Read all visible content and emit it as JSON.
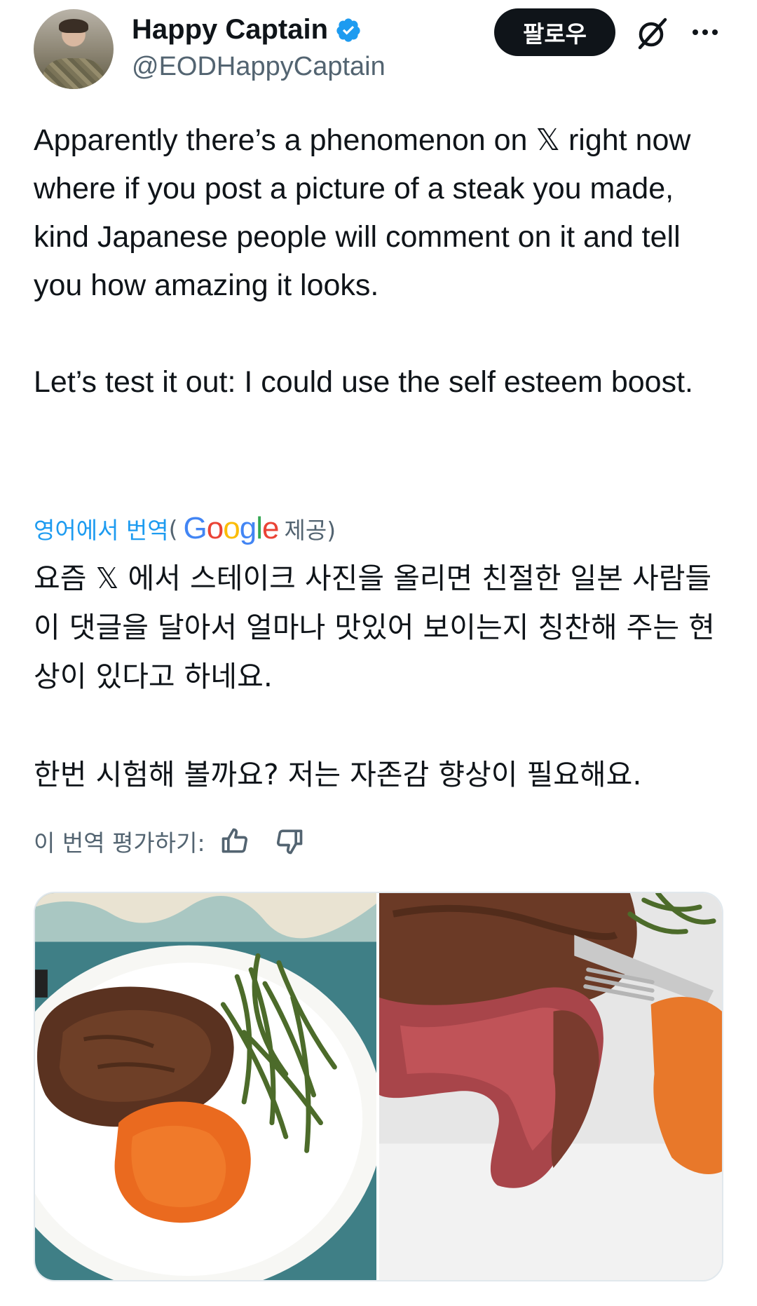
{
  "author": {
    "display_name": "Happy Captain",
    "handle": "@EODHappyCaptain",
    "verified": true,
    "avatar_icon": "avatar-photo"
  },
  "actions": {
    "follow_label": "팔로우",
    "grok_icon": "grok-icon",
    "more_icon": "more-icon"
  },
  "post": {
    "text": "Apparently there’s a phenomenon on 𝕏 right now where if you post a picture of a steak you made, kind Japanese people will comment on it and tell you how amazing it looks.\n\nLet’s test it out: I could use the self esteem boost."
  },
  "translation": {
    "link_label": "영어에서 번역",
    "open_paren": "(",
    "provider": "Google",
    "provided_label": "제공)",
    "text": "요즘 𝕏 에서 스테이크 사진을 올리면 친절한 일본 사람들이 댓글을 달아서 얼마나 맛있어 보이는지 칭찬해 주는 현상이 있다고 하네요.\n\n한번 시험해 볼까요? 저는 자존감 향상이 필요해요.",
    "rate_label": "이 번역 평가하기:",
    "thumbs_up_icon": "thumbs-up-icon",
    "thumbs_down_icon": "thumbs-down-icon"
  },
  "media": {
    "images": [
      {
        "name": "steak-plate-photo"
      },
      {
        "name": "steak-closeup-photo"
      }
    ]
  },
  "colors": {
    "text": "#0f1419",
    "secondary": "#536471",
    "accent": "#1d9bf0",
    "follow_bg": "#0f1419"
  }
}
